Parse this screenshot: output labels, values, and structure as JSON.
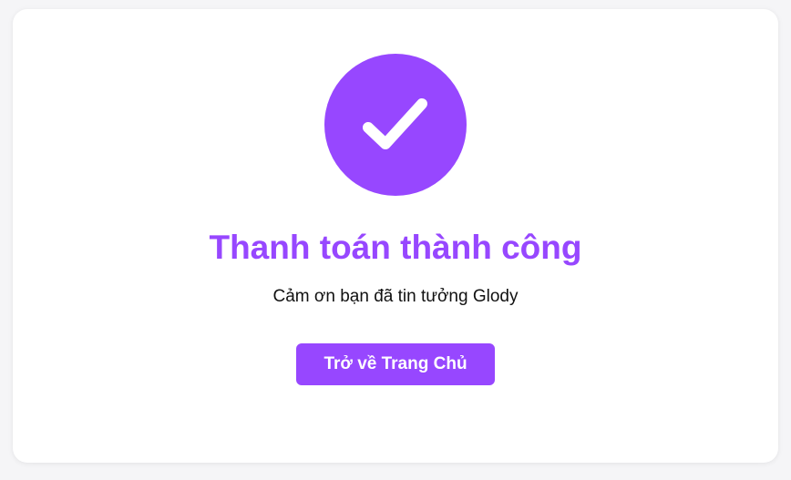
{
  "success": {
    "icon": "check-icon",
    "title": "Thanh toán thành công",
    "message": "Cảm ơn bạn đã tin tưởng Glody",
    "button_label": "Trở về Trang Chủ"
  },
  "colors": {
    "accent": "#9747ff",
    "card_background": "#ffffff",
    "page_background": "#f5f5f7",
    "text": "#111111"
  }
}
